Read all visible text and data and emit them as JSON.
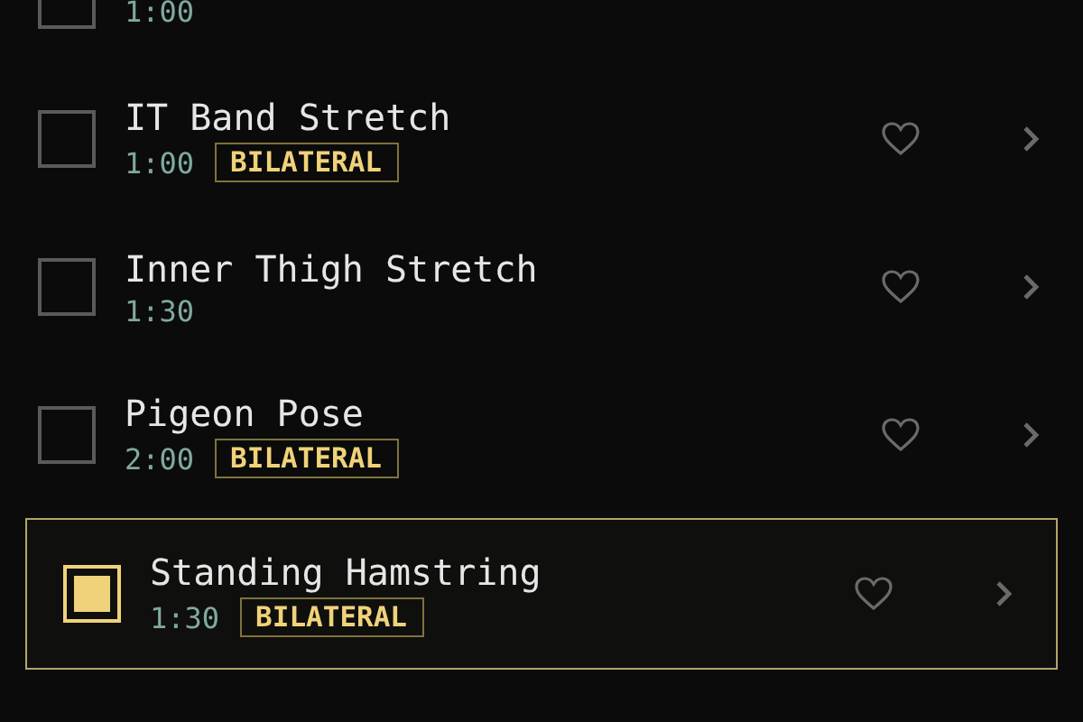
{
  "exercises": [
    {
      "kind": "partial",
      "duration": "1:00",
      "checked": false
    },
    {
      "kind": "full",
      "name": "IT Band Stretch",
      "duration": "1:00",
      "badge": "BILATERAL",
      "checked": false
    },
    {
      "kind": "full",
      "name": "Inner Thigh Stretch",
      "duration": "1:30",
      "checked": false
    },
    {
      "kind": "full",
      "name": "Pigeon Pose",
      "duration": "2:00",
      "badge": "BILATERAL",
      "checked": false
    },
    {
      "kind": "full",
      "name": "Standing Hamstring",
      "duration": "1:30",
      "badge": "BILATERAL",
      "checked": true
    }
  ]
}
